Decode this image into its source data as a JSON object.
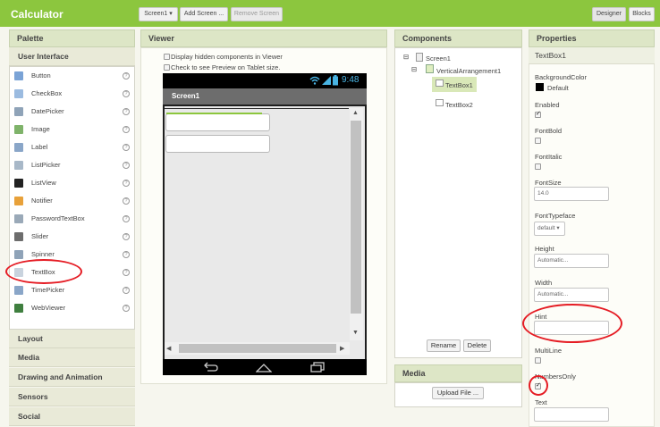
{
  "app": {
    "title": "Calculator",
    "screen_selector": "Screen1 ▾",
    "add_screen": "Add Screen ...",
    "remove_screen": "Remove Screen",
    "designer": "Designer",
    "blocks": "Blocks"
  },
  "palette": {
    "header": "Palette",
    "category": "User Interface",
    "items": [
      {
        "label": "Button",
        "icon": "button-icon"
      },
      {
        "label": "CheckBox",
        "icon": "checkbox-icon"
      },
      {
        "label": "DatePicker",
        "icon": "datepicker-icon"
      },
      {
        "label": "Image",
        "icon": "image-icon"
      },
      {
        "label": "Label",
        "icon": "label-icon"
      },
      {
        "label": "ListPicker",
        "icon": "listpicker-icon"
      },
      {
        "label": "ListView",
        "icon": "listview-icon"
      },
      {
        "label": "Notifier",
        "icon": "notifier-icon"
      },
      {
        "label": "PasswordTextBox",
        "icon": "passwordtextbox-icon"
      },
      {
        "label": "Slider",
        "icon": "slider-icon"
      },
      {
        "label": "Spinner",
        "icon": "spinner-icon"
      },
      {
        "label": "TextBox",
        "icon": "textbox-icon"
      },
      {
        "label": "TimePicker",
        "icon": "timepicker-icon"
      },
      {
        "label": "WebViewer",
        "icon": "webviewer-icon"
      }
    ],
    "help_glyph": "?",
    "categories": [
      "Layout",
      "Media",
      "Drawing and Animation",
      "Sensors",
      "Social"
    ]
  },
  "viewer": {
    "header": "Viewer",
    "option_hidden": "Display hidden components in Viewer",
    "option_tablet": "Check to see Preview on Tablet size.",
    "time": "9:48",
    "screen_title": "Screen1"
  },
  "components": {
    "header": "Components",
    "tree": [
      {
        "label": "Screen1"
      },
      {
        "label": "VerticalArrangement1"
      },
      {
        "label": "TextBox1"
      },
      {
        "label": "TextBox2"
      }
    ],
    "rename": "Rename",
    "delete": "Delete"
  },
  "media": {
    "header": "Media",
    "upload": "Upload File ..."
  },
  "properties": {
    "header": "Properties",
    "component": "TextBox1",
    "background_color_label": "BackgroundColor",
    "background_color_value": "Default",
    "background_color_swatch": "#000000",
    "enabled_label": "Enabled",
    "fontbold_label": "FontBold",
    "fontitalic_label": "FontItalic",
    "fontsize_label": "FontSize",
    "fontsize_value": "14.0",
    "fonttypeface_label": "FontTypeface",
    "fonttypeface_value": "default ▾",
    "height_label": "Height",
    "height_value": "Automatic...",
    "width_label": "Width",
    "width_value": "Automatic...",
    "hint_label": "Hint",
    "hint_value": "",
    "multiline_label": "MultiLine",
    "numbersonly_label": "NumbersOnly",
    "text_label": "Text",
    "text_value": ""
  },
  "colors": {
    "brand_green": "#8cc63e",
    "panel_header": "#dde6c6",
    "annotation_red": "#e51c24"
  }
}
